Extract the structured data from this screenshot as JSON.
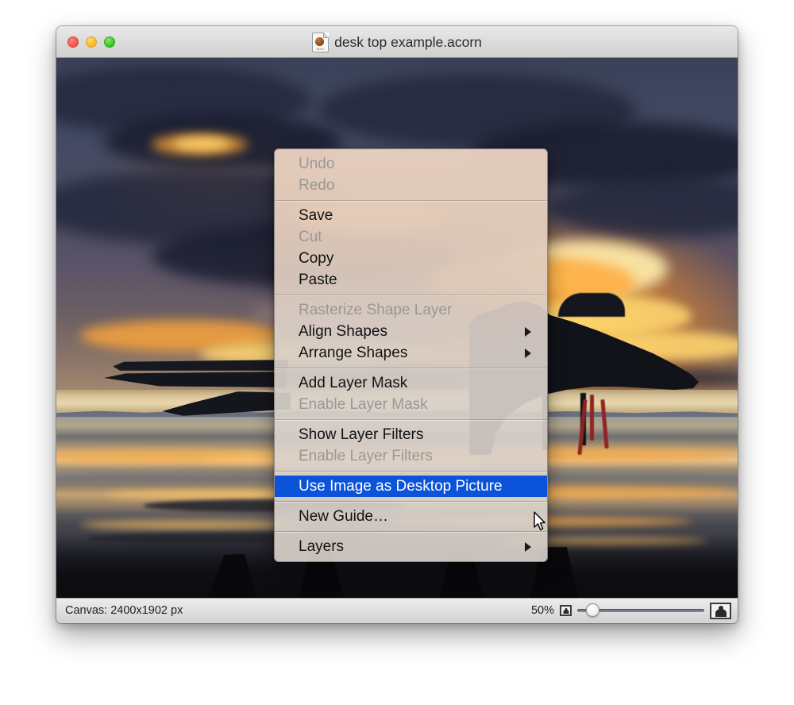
{
  "window": {
    "title": "desk top example.acorn",
    "doc_icon": "acorn-document-icon",
    "acorn_icon_label": "Acorn",
    "traffic_lights": [
      {
        "name": "close",
        "color": "#f4524a"
      },
      {
        "name": "minimize",
        "color": "#f9b627"
      },
      {
        "name": "zoom",
        "color": "#2fc221"
      }
    ]
  },
  "statusbar": {
    "canvas_info": "Canvas: 2400x1902 px",
    "zoom_percent": "50%",
    "zoom_out_icon": "small-image-icon",
    "zoom_in_icon": "large-image-icon",
    "slider_value": 8
  },
  "context_menu": {
    "selection_color": "#0b53d8",
    "groups": [
      {
        "items": [
          {
            "label": "Undo",
            "enabled": false,
            "submenu": false,
            "selected": false
          },
          {
            "label": "Redo",
            "enabled": false,
            "submenu": false,
            "selected": false
          }
        ]
      },
      {
        "items": [
          {
            "label": "Save",
            "enabled": true,
            "submenu": false,
            "selected": false
          },
          {
            "label": "Cut",
            "enabled": false,
            "submenu": false,
            "selected": false
          },
          {
            "label": "Copy",
            "enabled": true,
            "submenu": false,
            "selected": false
          },
          {
            "label": "Paste",
            "enabled": true,
            "submenu": false,
            "selected": false
          }
        ]
      },
      {
        "items": [
          {
            "label": "Rasterize Shape Layer",
            "enabled": false,
            "submenu": false,
            "selected": false
          },
          {
            "label": "Align Shapes",
            "enabled": true,
            "submenu": true,
            "selected": false
          },
          {
            "label": "Arrange Shapes",
            "enabled": true,
            "submenu": true,
            "selected": false
          }
        ]
      },
      {
        "items": [
          {
            "label": "Add Layer Mask",
            "enabled": true,
            "submenu": false,
            "selected": false
          },
          {
            "label": "Enable Layer Mask",
            "enabled": false,
            "submenu": false,
            "selected": false
          }
        ]
      },
      {
        "items": [
          {
            "label": "Show Layer Filters",
            "enabled": true,
            "submenu": false,
            "selected": false
          },
          {
            "label": "Enable Layer Filters",
            "enabled": false,
            "submenu": false,
            "selected": false
          }
        ]
      },
      {
        "items": [
          {
            "label": "Use Image as Desktop Picture",
            "enabled": true,
            "submenu": false,
            "selected": true
          }
        ]
      },
      {
        "items": [
          {
            "label": "New Guide…",
            "enabled": true,
            "submenu": false,
            "selected": false
          }
        ]
      },
      {
        "items": [
          {
            "label": "Layers",
            "enabled": true,
            "submenu": true,
            "selected": false
          }
        ]
      }
    ]
  },
  "canvas_photo": {
    "description": "Fighter jet silhouette on wet beach at sunset"
  }
}
